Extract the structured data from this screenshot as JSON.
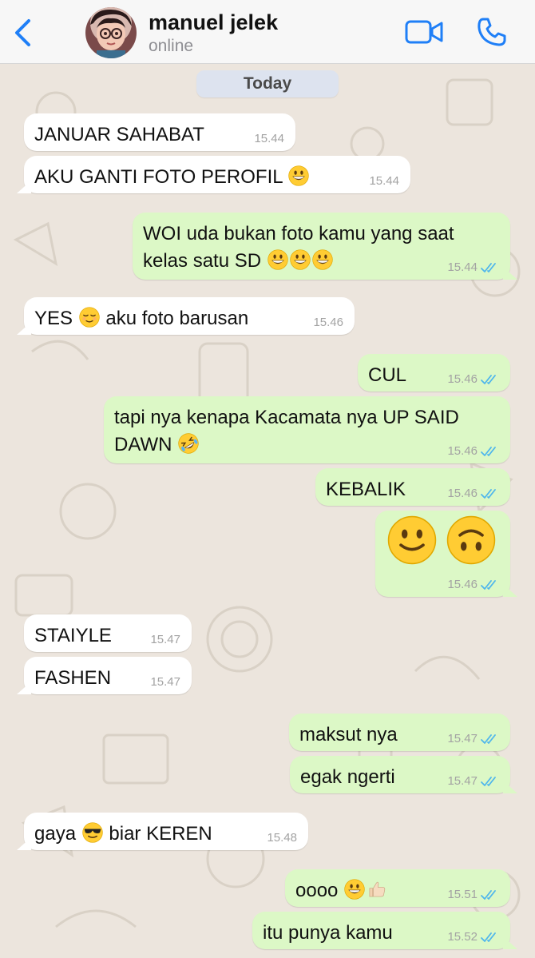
{
  "header": {
    "contact_name": "manuel jelek",
    "status": "online",
    "colors": {
      "accent": "#1f7ff7",
      "header_bg": "#f7f7f7"
    }
  },
  "chat": {
    "date_label": "Today",
    "colors": {
      "incoming": "#ffffff",
      "outgoing": "#dcf8c6",
      "wallpaper": "#ece5dd",
      "read_ticks": "#4fb6ec"
    },
    "messages": [
      {
        "dir": "in",
        "text": "JANUAR SAHABAT",
        "time": "15.44"
      },
      {
        "dir": "in",
        "text": "AKU GANTI FOTO PEROFIL",
        "emoji": [
          "grinning-face"
        ],
        "time": "15.44"
      },
      {
        "dir": "out",
        "text_line1": "WOI uda bukan foto kamu yang saat",
        "text_line2": "kelas satu SD",
        "emoji": [
          "grinning-face",
          "grinning-face",
          "grinning-face"
        ],
        "time": "15.44",
        "read": true
      },
      {
        "dir": "in",
        "text_a": "YES",
        "text_b": "aku foto barusan",
        "emoji": [
          "relieved-face"
        ],
        "time": "15.46"
      },
      {
        "dir": "out",
        "text": "CUL",
        "time": "15.46",
        "read": true
      },
      {
        "dir": "out",
        "text_line1": "tapi nya kenapa Kacamata nya UP SAID",
        "text_line2": "DAWN",
        "emoji": [
          "rolling-on-floor-laughing"
        ],
        "time": "15.46",
        "read": true
      },
      {
        "dir": "out",
        "text": "KEBALIK",
        "time": "15.46",
        "read": true
      },
      {
        "dir": "out",
        "emoji_only": [
          "slightly-smiling-face",
          "upside-down-face"
        ],
        "time": "15.46",
        "read": true
      },
      {
        "dir": "in",
        "text": "STAIYLE",
        "time": "15.47"
      },
      {
        "dir": "in",
        "text": "FASHEN",
        "time": "15.47"
      },
      {
        "dir": "out",
        "text": "maksut nya",
        "time": "15.47",
        "read": true
      },
      {
        "dir": "out",
        "text": "egak ngerti",
        "time": "15.47",
        "read": true
      },
      {
        "dir": "in",
        "text_a": "gaya",
        "text_b": "biar KEREN",
        "emoji": [
          "smiling-face-with-sunglasses"
        ],
        "time": "15.48"
      },
      {
        "dir": "out",
        "text": "oooo",
        "emoji": [
          "grinning-face",
          "thumbs-up"
        ],
        "time": "15.51",
        "read": true
      },
      {
        "dir": "out",
        "text": "itu punya kamu",
        "time": "15.52",
        "read": true
      }
    ]
  }
}
